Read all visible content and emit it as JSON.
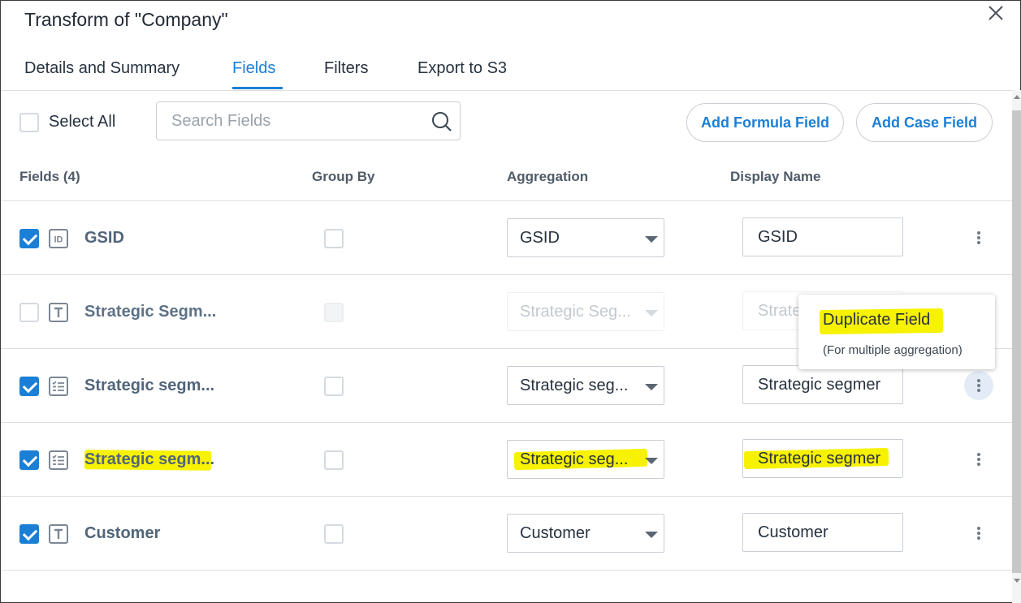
{
  "dialog": {
    "title": "Transform of \"Company\""
  },
  "tabs": [
    {
      "label": "Details and Summary"
    },
    {
      "label": "Fields"
    },
    {
      "label": "Filters"
    },
    {
      "label": "Export to S3"
    }
  ],
  "active_tab": "Fields",
  "toolbar": {
    "select_all_label": "Select All",
    "select_all_checked": false,
    "search_placeholder": "Search Fields",
    "add_formula_label": "Add Formula Field",
    "add_case_label": "Add Case Field"
  },
  "columns": {
    "fields": "Fields (4)",
    "group_by": "Group By",
    "aggregation": "Aggregation",
    "display_name": "Display Name"
  },
  "rows": [
    {
      "checked": true,
      "type_icon": "id-icon",
      "name": "GSID",
      "group_by": false,
      "aggregation": "GSID",
      "display_name": "GSID",
      "disabled": false
    },
    {
      "checked": false,
      "type_icon": "text-icon",
      "name": "Strategic Segm...",
      "group_by": false,
      "aggregation": "Strategic Seg...",
      "display_name": "Strate",
      "disabled": true
    },
    {
      "checked": true,
      "type_icon": "picklist-icon",
      "name": "Strategic segm...",
      "group_by": false,
      "aggregation": "Strategic seg...",
      "display_name": "Strategic segmer",
      "disabled": false
    },
    {
      "checked": true,
      "type_icon": "picklist-icon",
      "name": "Strategic segm...",
      "group_by": false,
      "aggregation": "Strategic seg...",
      "display_name": "Strategic segmer",
      "disabled": false,
      "highlighted": true
    },
    {
      "checked": true,
      "type_icon": "text-icon",
      "name": "Customer",
      "group_by": false,
      "aggregation": "Customer",
      "display_name": "Customer",
      "disabled": false
    }
  ],
  "context_menu": {
    "title": "Duplicate Field",
    "subtitle": "(For multiple aggregation)"
  },
  "colors": {
    "accent": "#1c7fd6",
    "highlight": "#f7f200",
    "field_name": "#51657b"
  }
}
